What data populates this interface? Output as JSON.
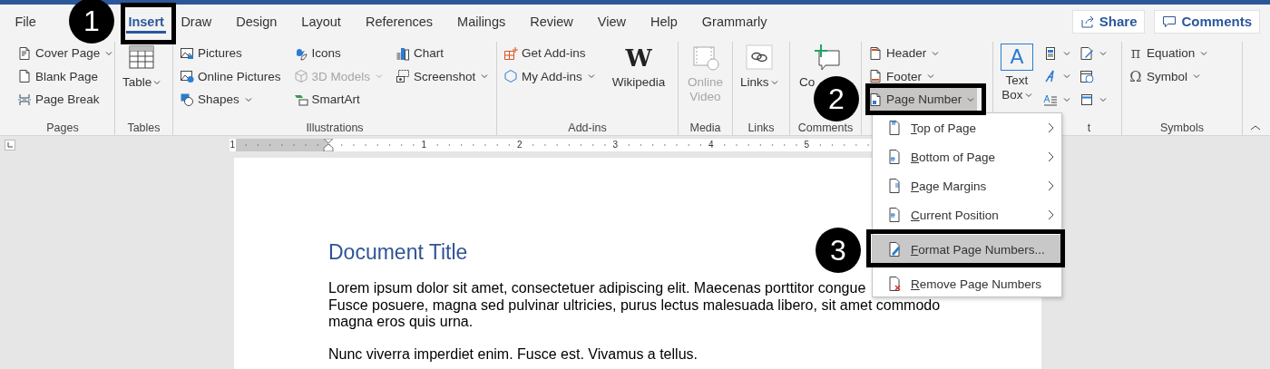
{
  "tabs": [
    {
      "label": "File",
      "selected": false
    },
    {
      "label": "Insert",
      "selected": true
    },
    {
      "label": "Draw",
      "selected": false
    },
    {
      "label": "Design",
      "selected": false
    },
    {
      "label": "Layout",
      "selected": false
    },
    {
      "label": "References",
      "selected": false
    },
    {
      "label": "Mailings",
      "selected": false
    },
    {
      "label": "Review",
      "selected": false
    },
    {
      "label": "View",
      "selected": false
    },
    {
      "label": "Help",
      "selected": false
    },
    {
      "label": "Grammarly",
      "selected": false
    }
  ],
  "share_button": "Share",
  "comments_button": "Comments",
  "ribbon_groups": [
    {
      "label": "Pages",
      "columns": [
        [
          {
            "kind": "small",
            "label": "Cover Page",
            "dropdown": true,
            "disabled": false
          },
          {
            "kind": "small",
            "label": "Blank Page",
            "dropdown": false,
            "disabled": false
          },
          {
            "kind": "small",
            "label": "Page Break",
            "dropdown": false,
            "disabled": false
          }
        ]
      ]
    },
    {
      "label": "Tables",
      "columns": [
        [
          {
            "kind": "large",
            "label": "Table",
            "dropdown": true,
            "disabled": false
          }
        ]
      ]
    },
    {
      "label": "Illustrations",
      "columns": [
        [
          {
            "kind": "small",
            "label": "Pictures",
            "dropdown": false,
            "disabled": false
          },
          {
            "kind": "small",
            "label": "Online Pictures",
            "dropdown": false,
            "disabled": false
          },
          {
            "kind": "small",
            "label": "Shapes",
            "dropdown": true,
            "disabled": false
          }
        ],
        [
          {
            "kind": "small",
            "label": "Icons",
            "dropdown": false,
            "disabled": false
          },
          {
            "kind": "small",
            "label": "3D Models",
            "dropdown": true,
            "disabled": true
          },
          {
            "kind": "small",
            "label": "SmartArt",
            "dropdown": false,
            "disabled": false
          }
        ],
        [
          {
            "kind": "small",
            "label": "Chart",
            "dropdown": false,
            "disabled": false
          },
          {
            "kind": "small",
            "label": "Screenshot",
            "dropdown": true,
            "disabled": false
          }
        ]
      ]
    },
    {
      "label": "Add-ins",
      "columns": [
        [
          {
            "kind": "small",
            "label": "Get Add-ins",
            "dropdown": false,
            "disabled": false
          },
          {
            "kind": "small",
            "label": "My Add-ins",
            "dropdown": true,
            "disabled": false
          }
        ],
        [
          {
            "kind": "large",
            "label": "Wikipedia",
            "glyph": "W",
            "dropdown": false,
            "disabled": false
          }
        ]
      ]
    },
    {
      "label": "Media",
      "columns": [
        [
          {
            "kind": "large",
            "label": "Online Video",
            "dropdown": false,
            "disabled": true
          }
        ]
      ]
    },
    {
      "label": "Links",
      "columns": [
        [
          {
            "kind": "large",
            "label": "Links",
            "dropdown": true,
            "disabled": false
          }
        ]
      ]
    },
    {
      "label": "Comments",
      "columns": [
        [
          {
            "kind": "large",
            "label": "Co",
            "dropdown": false,
            "disabled": false
          }
        ]
      ]
    },
    {
      "columns": [
        [
          {
            "kind": "small",
            "label": "Header",
            "dropdown": true,
            "disabled": false,
            "pressed": false
          },
          {
            "kind": "small",
            "label": "Footer",
            "dropdown": true,
            "disabled": false,
            "pressed": false
          },
          {
            "kind": "small",
            "label": "Page Number",
            "dropdown": true,
            "disabled": false,
            "pressed": true
          }
        ]
      ]
    },
    {
      "label": "t",
      "columns": [
        [
          {
            "kind": "large",
            "label": "Text Box",
            "glyph": "A",
            "dropdown": true,
            "disabled": false
          }
        ],
        [
          {
            "kind": "icon",
            "dropdown": true,
            "disabled": false
          },
          {
            "kind": "icon",
            "dropdown": true,
            "disabled": false
          },
          {
            "kind": "icon",
            "dropdown": true,
            "disabled": false
          }
        ],
        [
          {
            "kind": "icon",
            "dropdown": true,
            "disabled": false
          },
          {
            "kind": "icon",
            "dropdown": false,
            "disabled": false
          },
          {
            "kind": "icon",
            "dropdown": true,
            "disabled": false
          }
        ]
      ]
    },
    {
      "label": "Symbols",
      "columns": [
        [
          {
            "kind": "small",
            "label": "Equation",
            "glyph": "π",
            "dropdown": true,
            "disabled": false
          },
          {
            "kind": "small",
            "label": "Symbol",
            "glyph": "Ω",
            "dropdown": true,
            "disabled": false
          }
        ]
      ]
    }
  ],
  "ruler_numbers": [
    "1",
    "1",
    "2",
    "3",
    "4",
    "5"
  ],
  "menu": [
    {
      "label": "Top of Page",
      "submenu": true,
      "highlighted": false
    },
    {
      "label": "Bottom of Page",
      "submenu": true,
      "highlighted": false
    },
    {
      "label": "Page Margins",
      "submenu": true,
      "highlighted": false
    },
    {
      "label": "Current Position",
      "submenu": true,
      "highlighted": false
    },
    {
      "label": "Format Page Numbers...",
      "submenu": false,
      "highlighted": true
    },
    {
      "label": "Remove Page Numbers",
      "submenu": false,
      "highlighted": false
    }
  ],
  "callouts": [
    {
      "number": "1"
    },
    {
      "number": "2"
    },
    {
      "number": "3"
    }
  ],
  "document": {
    "title": "Document Title",
    "paragraphs": [
      {
        "lines": [
          "Lorem ipsum dolor sit amet, consectetuer adipiscing elit. Maecenas porttitor congue",
          "Fusce posuere, magna sed pulvinar ultricies, purus lectus malesuada libero, sit amet commodo",
          "magna eros quis urna."
        ]
      },
      {
        "lines": [
          "Nunc viverra imperdiet enim. Fusce est. Vivamus a tellus."
        ]
      }
    ]
  }
}
